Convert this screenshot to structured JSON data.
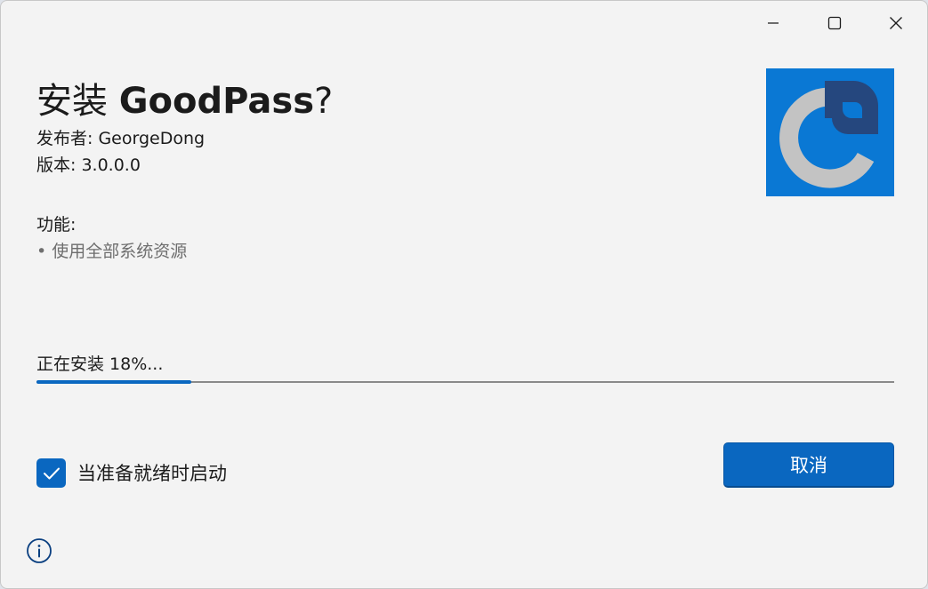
{
  "window": {
    "controls": {
      "minimize_icon": "minimize-icon",
      "maximize_icon": "maximize-icon",
      "close_icon": "close-icon"
    }
  },
  "header": {
    "title_prefix": "安装 ",
    "app_name": "GoodPass",
    "title_suffix": "?",
    "publisher_label": "发布者: ",
    "publisher": "GeorgeDong",
    "version_label": "版本: ",
    "version": "3.0.0.0",
    "app_icon": "goodpass-logo"
  },
  "features": {
    "heading": "功能:",
    "items": [
      "• 使用全部系统资源"
    ]
  },
  "progress": {
    "text": "正在安装 18%...",
    "percent": 18
  },
  "options": {
    "launch_when_ready_label": "当准备就绪时启动",
    "launch_when_ready_checked": true
  },
  "actions": {
    "cancel_label": "取消"
  },
  "footer": {
    "info_icon": "info-icon"
  },
  "colors": {
    "accent": "#0a67c0",
    "icon_bg": "#0a78d4",
    "window_bg": "#f3f3f3"
  }
}
